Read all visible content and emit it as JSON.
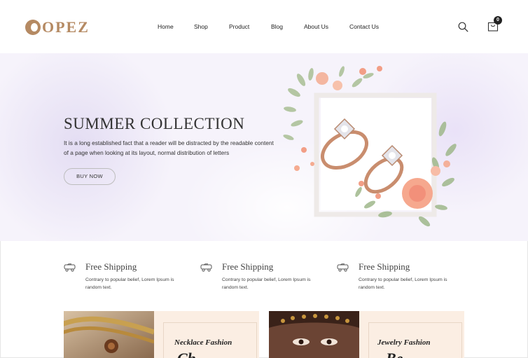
{
  "brand": {
    "logo_text": "OPEZ",
    "accent_color": "#b58a63"
  },
  "nav": {
    "items": [
      {
        "label": "Home"
      },
      {
        "label": "Shop"
      },
      {
        "label": "Product"
      },
      {
        "label": "Blog"
      },
      {
        "label": "About Us"
      },
      {
        "label": "Contact Us"
      }
    ]
  },
  "header": {
    "search_icon": "search-icon",
    "cart_icon": "shopping-bag-icon",
    "cart_count": "0"
  },
  "hero": {
    "title": "SUMMER COLLECTION",
    "description": "It is a long established fact that a reader will be distracted by the readable content of a page when looking at its layout, normal distribution of letters",
    "button_label": "BUY NOW"
  },
  "features": [
    {
      "icon": "truck-icon",
      "title": "Free Shipping",
      "text": "Contrary to popular belief, Lorem Ipsum is random text."
    },
    {
      "icon": "truck-icon",
      "title": "Free Shipping",
      "text": "Contrary to popular belief, Lorem Ipsum is random text."
    },
    {
      "icon": "truck-icon",
      "title": "Free Shipping",
      "text": "Contrary to popular belief, Lorem Ipsum is random text."
    }
  ],
  "banners": [
    {
      "label": "Necklace Fashion"
    },
    {
      "label": "Jewelry Fashion"
    }
  ]
}
